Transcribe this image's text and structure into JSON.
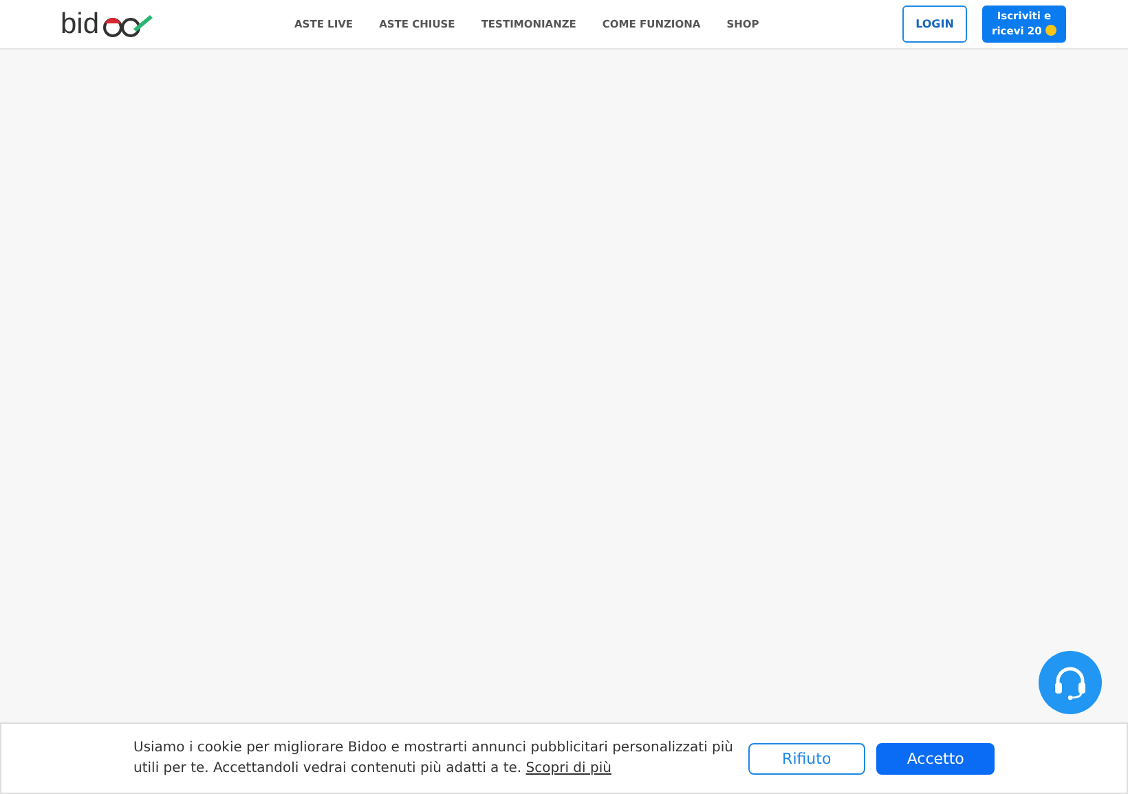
{
  "header": {
    "logo_text": "bid",
    "nav": [
      {
        "label": "ASTE LIVE"
      },
      {
        "label": "ASTE CHIUSE"
      },
      {
        "label": "TESTIMONIANZE"
      },
      {
        "label": "COME FUNZIONA"
      },
      {
        "label": "SHOP"
      }
    ],
    "login": "LOGIN",
    "signup": [
      "Iscriviti e",
      "ricevi 20"
    ]
  },
  "cookie_banner": {
    "text": "Usiamo i cookie per migliorare Bidoo e mostrarti annunci pubblicitari personalizzati più utili per te. Accettandoli vedrai contenuti più adatti a te.",
    "link": "Scopri di più",
    "reject": "Rifiuto",
    "accept": "Accetto"
  }
}
